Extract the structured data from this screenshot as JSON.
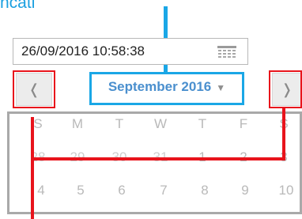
{
  "heading": "ncati",
  "datetime_input": {
    "value": "26/09/2016 10:58:38"
  },
  "icons": {
    "calendar": "calendar-icon",
    "prev": "chevron-left-icon",
    "next": "chevron-right-icon",
    "dropdown": "caret-down-icon"
  },
  "nav": {
    "prev_label": "❬",
    "next_label": "❭",
    "month_label": "September 2016",
    "caret": "▼"
  },
  "weekdays": [
    "S",
    "M",
    "T",
    "W",
    "T",
    "F",
    "S"
  ],
  "weeks": [
    [
      "28",
      "29",
      "30",
      "31",
      "1",
      "2",
      "3"
    ],
    [
      "4",
      "5",
      "6",
      "7",
      "8",
      "9",
      "10"
    ]
  ],
  "colors": {
    "highlight_blue": "#1aa7e6",
    "highlight_red": "#e8141c",
    "grid_border": "#a9a9a9",
    "month_text": "#4a8fce"
  }
}
